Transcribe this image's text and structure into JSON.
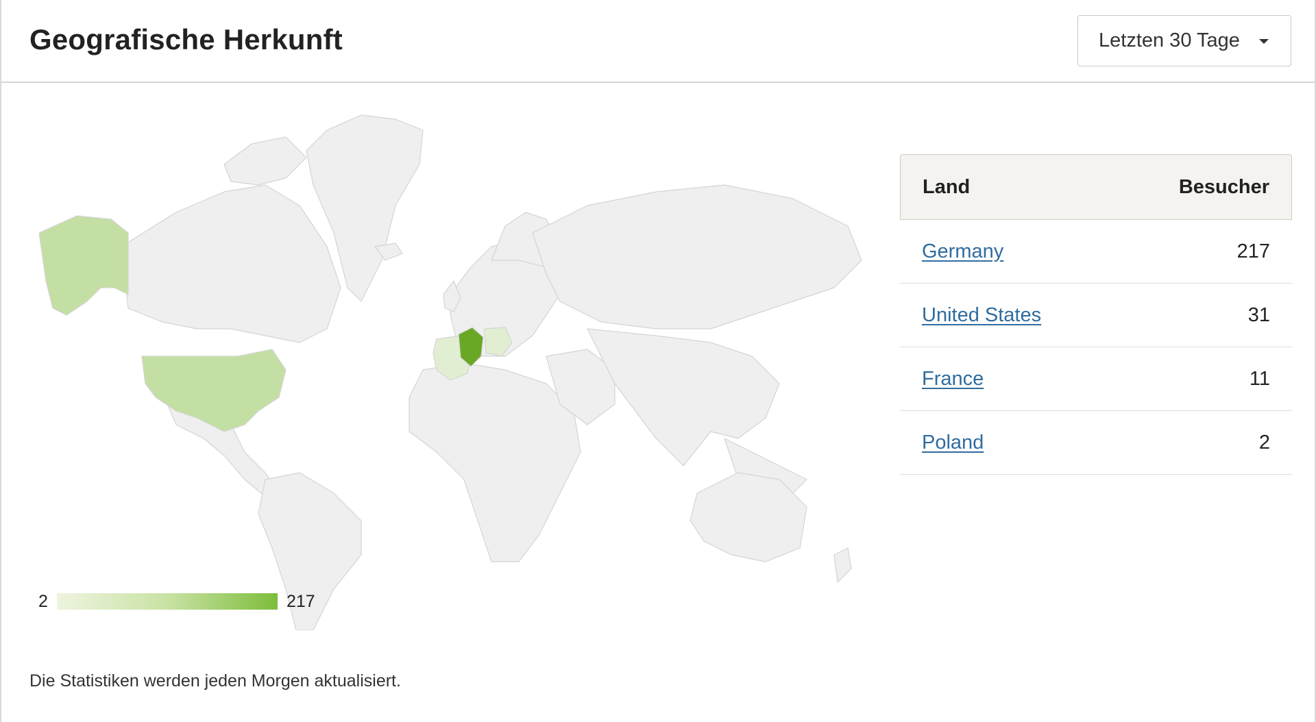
{
  "header": {
    "title": "Geografische Herkunft",
    "range_selected": "Letzten 30 Tage"
  },
  "map": {
    "colors": {
      "land": "#efefef",
      "border": "#d4d4d4",
      "highest": "#6aa724",
      "mid": "#c4dfa3",
      "low": "#e2eed1"
    },
    "legend": {
      "min": "2",
      "max": "217"
    },
    "highlighted": [
      {
        "country": "Germany",
        "value": 217
      },
      {
        "country": "United States",
        "value": 31
      },
      {
        "country": "France",
        "value": 11
      },
      {
        "country": "Poland",
        "value": 2
      }
    ]
  },
  "table": {
    "header": {
      "country": "Land",
      "visitors": "Besucher"
    },
    "rows": [
      {
        "country": "Germany",
        "visitors": "217"
      },
      {
        "country": "United States",
        "visitors": "31"
      },
      {
        "country": "France",
        "visitors": "11"
      },
      {
        "country": "Poland",
        "visitors": "2"
      }
    ]
  },
  "footer": {
    "note": "Die Statistiken werden jeden Morgen aktualisiert."
  }
}
